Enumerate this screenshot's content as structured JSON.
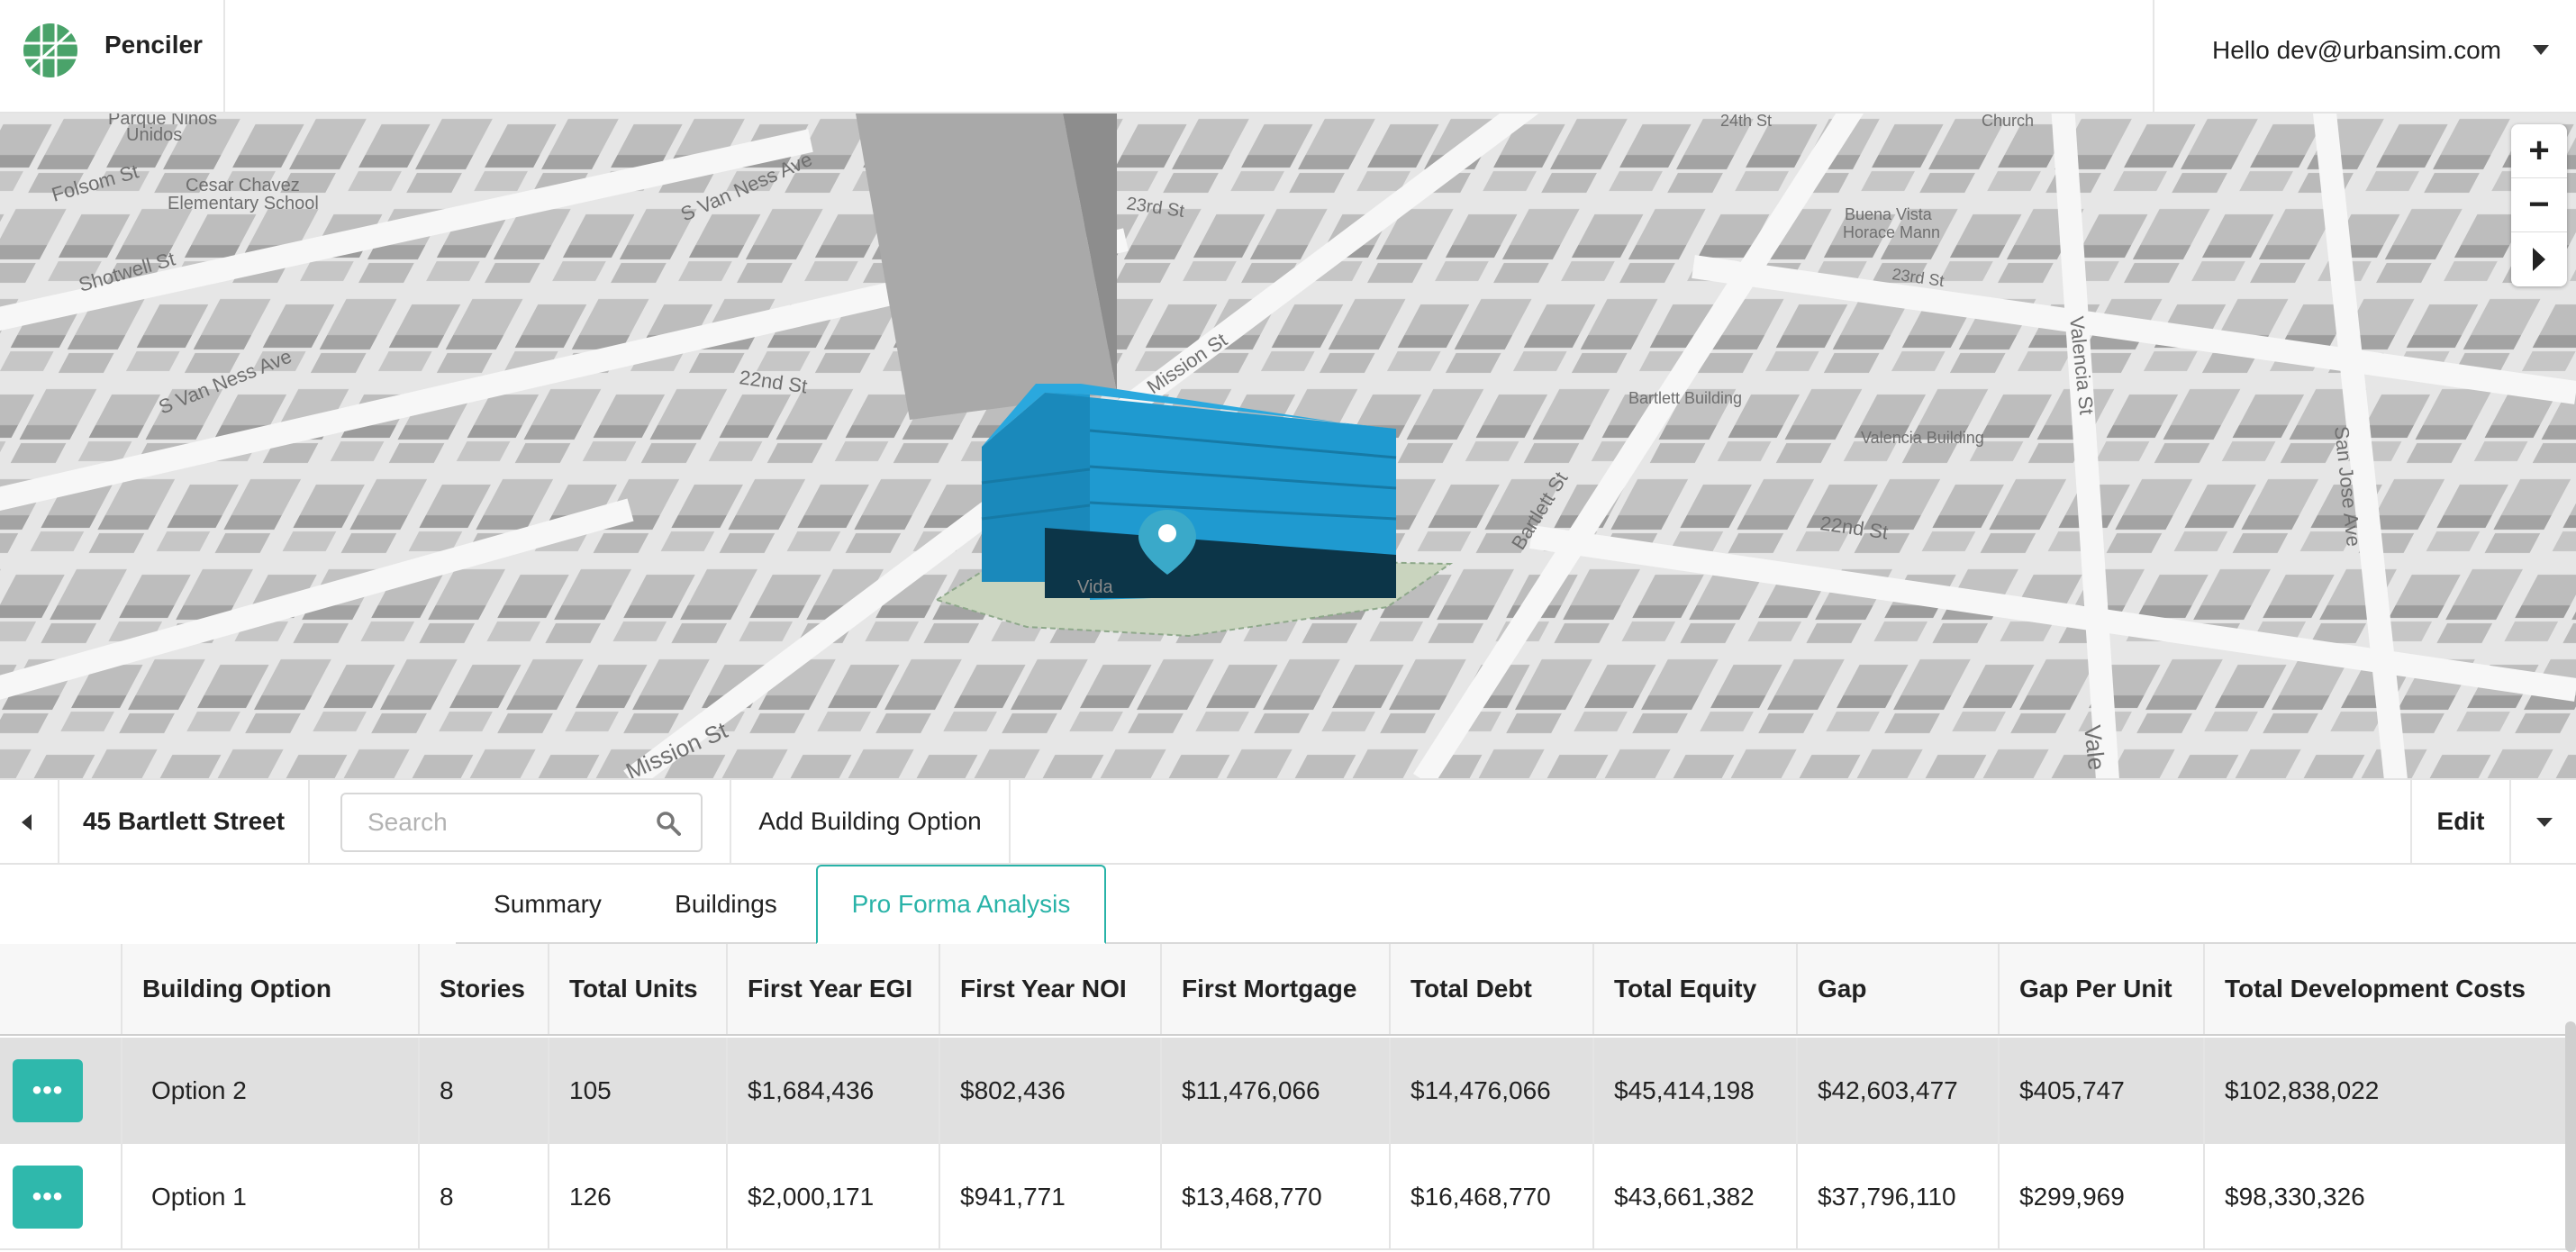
{
  "header": {
    "app_name": "Penciler",
    "user_greeting": "Hello dev@urbansim.com"
  },
  "map": {
    "labels": {
      "folsom": "Folsom St",
      "parque": "Parque Niños",
      "parque2": "Unidos",
      "cesar": "Cesar Chavez",
      "cesar2": "Elementary School",
      "shotwell": "Shotwell St",
      "svanness1": "S Van Ness Ave",
      "svanness2": "S Van Ness Ave",
      "st22a": "22nd St",
      "st22b": "22nd St",
      "st23a": "23rd St",
      "st23b": "23rd St",
      "st24": "24th St",
      "church": "Church",
      "mission1": "Mission St",
      "mission2": "Mission St",
      "bartlett": "Bartlett St",
      "buenavista1": "Buena Vista",
      "buenavista2": "Horace Mann",
      "bartlettbldg": "Bartlett Building",
      "valenciabldg": "Valencia Building",
      "valencia1": "Valencia St",
      "valencia2": "Vale",
      "sanjose": "San Jose Ave",
      "vida": "Vida"
    },
    "controls": {
      "zoom_in": "+",
      "zoom_out": "−"
    }
  },
  "toolbar": {
    "address": "45 Bartlett Street",
    "search_placeholder": "Search",
    "add_building_option": "Add Building Option",
    "edit": "Edit"
  },
  "tabs": {
    "summary": "Summary",
    "buildings": "Buildings",
    "pro_forma": "Pro Forma Analysis",
    "active": "Pro Forma Analysis"
  },
  "table": {
    "columns": [
      "Building Option",
      "Stories",
      "Total Units",
      "First Year EGI",
      "First Year NOI",
      "First Mortgage",
      "Total Debt",
      "Total Equity",
      "Gap",
      "Gap Per Unit",
      "Total Development Costs"
    ],
    "menu_label": "•••",
    "rows": [
      [
        "Option 2",
        "8",
        "105",
        "$1,684,436",
        "$802,436",
        "$11,476,066",
        "$14,476,066",
        "$45,414,198",
        "$42,603,477",
        "$405,747",
        "$102,838,022"
      ],
      [
        "Option 1",
        "8",
        "126",
        "$2,000,171",
        "$941,771",
        "$13,468,770",
        "$16,468,770",
        "$43,661,382",
        "$37,796,110",
        "$299,969",
        "$98,330,326"
      ]
    ]
  },
  "colors": {
    "accent": "#2fb8ac",
    "building": "#1e94c8",
    "building_dark": "#0c3548",
    "map_bg": "#ececec",
    "block": "#b4b4b4"
  }
}
